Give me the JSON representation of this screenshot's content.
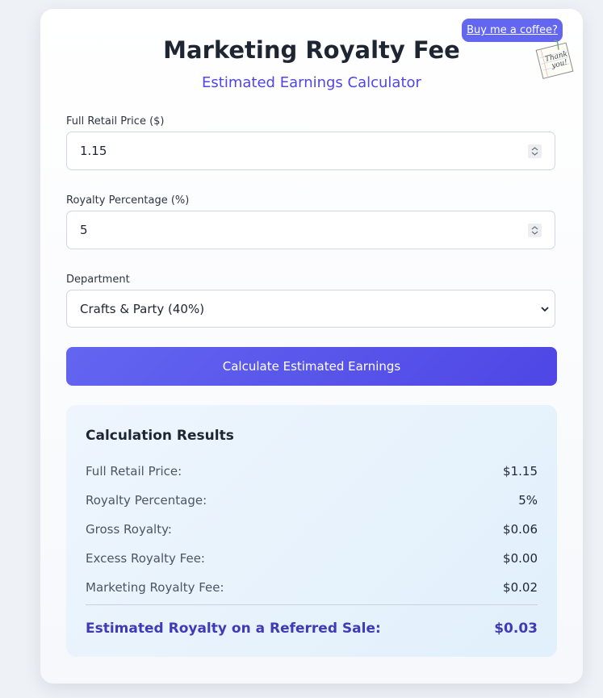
{
  "header": {
    "title": "Marketing Royalty Fee",
    "subtitle": "Estimated Earnings Calculator"
  },
  "coffee": {
    "label": "Buy me a coffee?",
    "note_line1": "Thank",
    "note_line2": "you!"
  },
  "form": {
    "price": {
      "label": "Full Retail Price ($)",
      "value": "1.15"
    },
    "royalty": {
      "label": "Royalty Percentage (%)",
      "value": "5"
    },
    "department": {
      "label": "Department",
      "selected": "Crafts & Party (40%)"
    },
    "submit_label": "Calculate Estimated Earnings"
  },
  "results": {
    "title": "Calculation Results",
    "rows": [
      {
        "label": "Full Retail Price:",
        "value": "$1.15"
      },
      {
        "label": "Royalty Percentage:",
        "value": "5%"
      },
      {
        "label": "Gross Royalty:",
        "value": "$0.06"
      },
      {
        "label": "Excess Royalty Fee:",
        "value": "$0.00"
      },
      {
        "label": "Marketing Royalty Fee:",
        "value": "$0.02"
      }
    ],
    "total": {
      "label": "Estimated Royalty on a Referred Sale:",
      "value": "$0.03"
    }
  },
  "colors": {
    "accent": "#4f46e5",
    "button": "#6366f1",
    "results_bg": "#e6f2fd"
  },
  "icons": {
    "spinner": "number-spinner-icon",
    "select": "chevron-down-icon",
    "note": "thank-you-note-icon"
  }
}
